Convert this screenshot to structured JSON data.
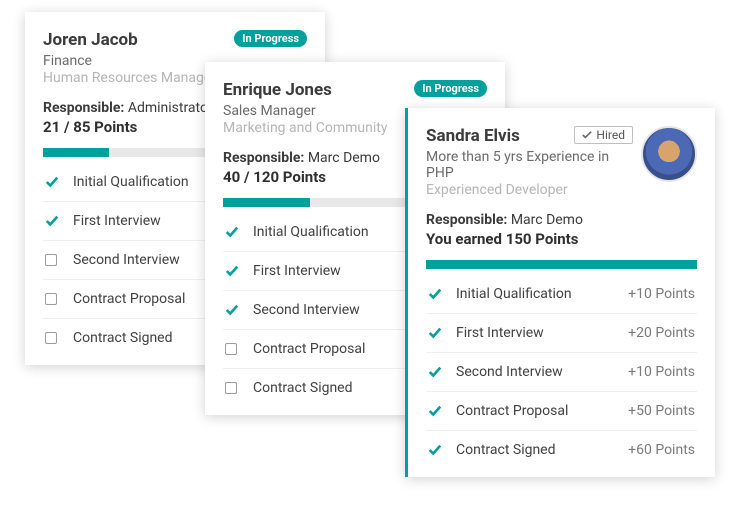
{
  "cards": [
    {
      "name": "Joren Jacob",
      "sub1": "Finance",
      "sub2": "Human Resources Manager",
      "status": "In Progress",
      "responsible_label": "Responsible:",
      "responsible_value": "Administrator",
      "score": "21 / 85 Points",
      "progress_pct": 25,
      "stages": [
        {
          "label": "Initial Qualification",
          "done": true
        },
        {
          "label": "First Interview",
          "done": true
        },
        {
          "label": "Second Interview",
          "done": false
        },
        {
          "label": "Contract Proposal",
          "done": false
        },
        {
          "label": "Contract Signed",
          "done": false
        }
      ]
    },
    {
      "name": "Enrique Jones",
      "sub1": "Sales Manager",
      "sub2": "Marketing and Community",
      "status": "In Progress",
      "responsible_label": "Responsible:",
      "responsible_value": "Marc Demo",
      "score": "40 / 120 Points",
      "progress_pct": 33,
      "stages": [
        {
          "label": "Initial Qualification",
          "done": true
        },
        {
          "label": "First Interview",
          "done": true
        },
        {
          "label": "Second Interview",
          "done": true
        },
        {
          "label": "Contract Proposal",
          "done": false
        },
        {
          "label": "Contract Signed",
          "done": false
        }
      ]
    },
    {
      "name": "Sandra Elvis",
      "sub1": "More than 5 yrs Experience in PHP",
      "sub2": "Experienced Developer",
      "status": "Hired",
      "responsible_label": "Responsible:",
      "responsible_value": "Marc Demo",
      "score": "You earned 150 Points",
      "progress_pct": 100,
      "stages": [
        {
          "label": "Initial Qualification",
          "done": true,
          "points": "+10 Points"
        },
        {
          "label": "First Interview",
          "done": true,
          "points": "+20 Points"
        },
        {
          "label": "Second Interview",
          "done": true,
          "points": "+10 Points"
        },
        {
          "label": "Contract Proposal",
          "done": true,
          "points": "+50 Points"
        },
        {
          "label": "Contract Signed",
          "done": true,
          "points": "+60 Points"
        }
      ]
    }
  ]
}
